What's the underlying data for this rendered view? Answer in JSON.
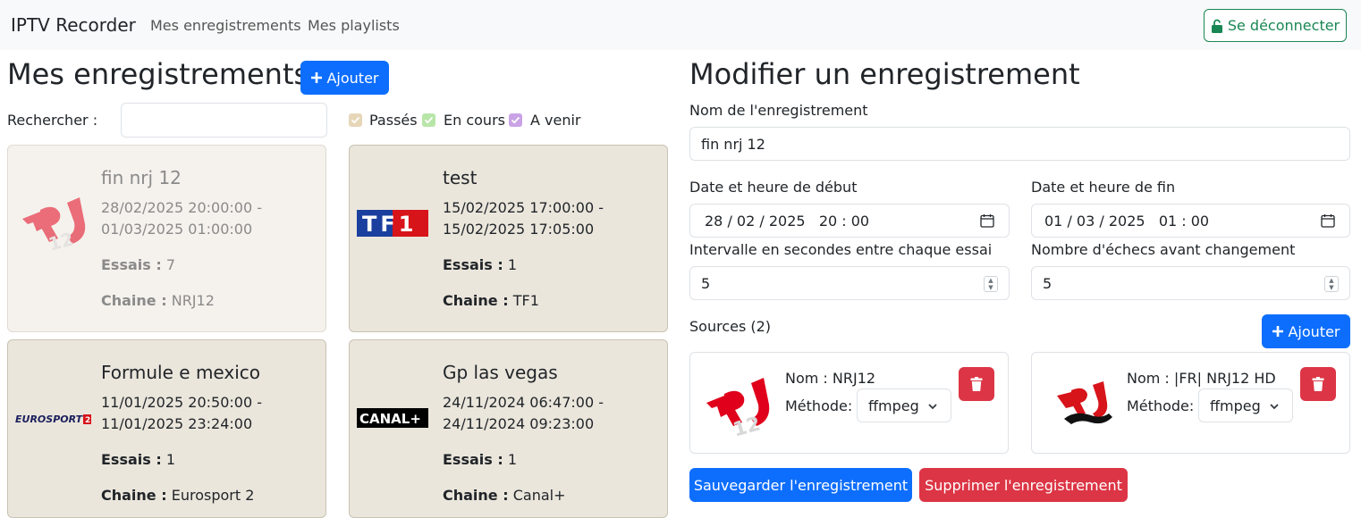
{
  "nav": {
    "brand": "IPTV Recorder",
    "links": [
      "Mes enregistrements",
      "Mes playlists"
    ],
    "logout_label": "Se déconnecter"
  },
  "list": {
    "title": "Mes enregistrements",
    "add_label": "Ajouter",
    "search_label": "Rechercher :",
    "search_value": "",
    "filters": [
      {
        "label": "Passés",
        "checked": true,
        "color": "#e6d7b8"
      },
      {
        "label": "En cours",
        "checked": true,
        "color": "#b8e6a8"
      },
      {
        "label": "A venir",
        "checked": true,
        "color": "#c9a3e6"
      }
    ],
    "tries_label": "Essais :",
    "chaine_label": "Chaine :",
    "cards": [
      {
        "title": "fin nrj 12",
        "start": "28/02/2025 20:00:00 -",
        "end": "01/03/2025 01:00:00",
        "tries": "7",
        "chaine": "NRJ12",
        "logo": "nrj12-logo",
        "state": "past"
      },
      {
        "title": "test",
        "start": "15/02/2025 17:00:00 -",
        "end": "15/02/2025 17:05:00",
        "tries": "1",
        "chaine": "TF1",
        "logo": "tf1-logo",
        "state": "normal"
      },
      {
        "title": "Formule e mexico",
        "start": "11/01/2025 20:50:00 -",
        "end": "11/01/2025 23:24:00",
        "tries": "1",
        "chaine": "Eurosport 2",
        "logo": "eurosport2-logo",
        "state": "normal"
      },
      {
        "title": "Gp las vegas",
        "start": "24/11/2024 06:47:00 -",
        "end": "24/11/2024 09:23:00",
        "tries": "1",
        "chaine": "Canal+",
        "logo": "canalplus-logo",
        "state": "normal"
      }
    ]
  },
  "edit": {
    "title": "Modifier un enregistrement",
    "name_label": "Nom de l'enregistrement",
    "name_value": "fin nrj 12",
    "start_label": "Date et heure de début",
    "start_value": "28 / 02 / 2025   20 : 00",
    "end_label": "Date et heure de fin",
    "end_value": "01 / 03 / 2025   01 : 00",
    "interval_label": "Intervalle en secondes entre chaque essai",
    "interval_value": "5",
    "failures_label": "Nombre d'échecs avant changement",
    "failures_value": "5",
    "sources_label": "Sources (2)",
    "add_source_label": "Ajouter",
    "nom_prefix": "Nom :",
    "method_label": "Méthode:",
    "sources": [
      {
        "name": "NRJ12",
        "method": "ffmpeg",
        "logo": "nrj12-logo"
      },
      {
        "name": "|FR| NRJ12 HD",
        "method": "ffmpeg",
        "logo": "nrj-panther-logo"
      }
    ],
    "save_label": "Sauvegarder l'enregistrement",
    "delete_label": "Supprimer l'enregistrement"
  },
  "colors": {
    "primary": "#0d6efd",
    "danger": "#dc3545",
    "success": "#198754",
    "card_bg": "#ebe6dc"
  }
}
